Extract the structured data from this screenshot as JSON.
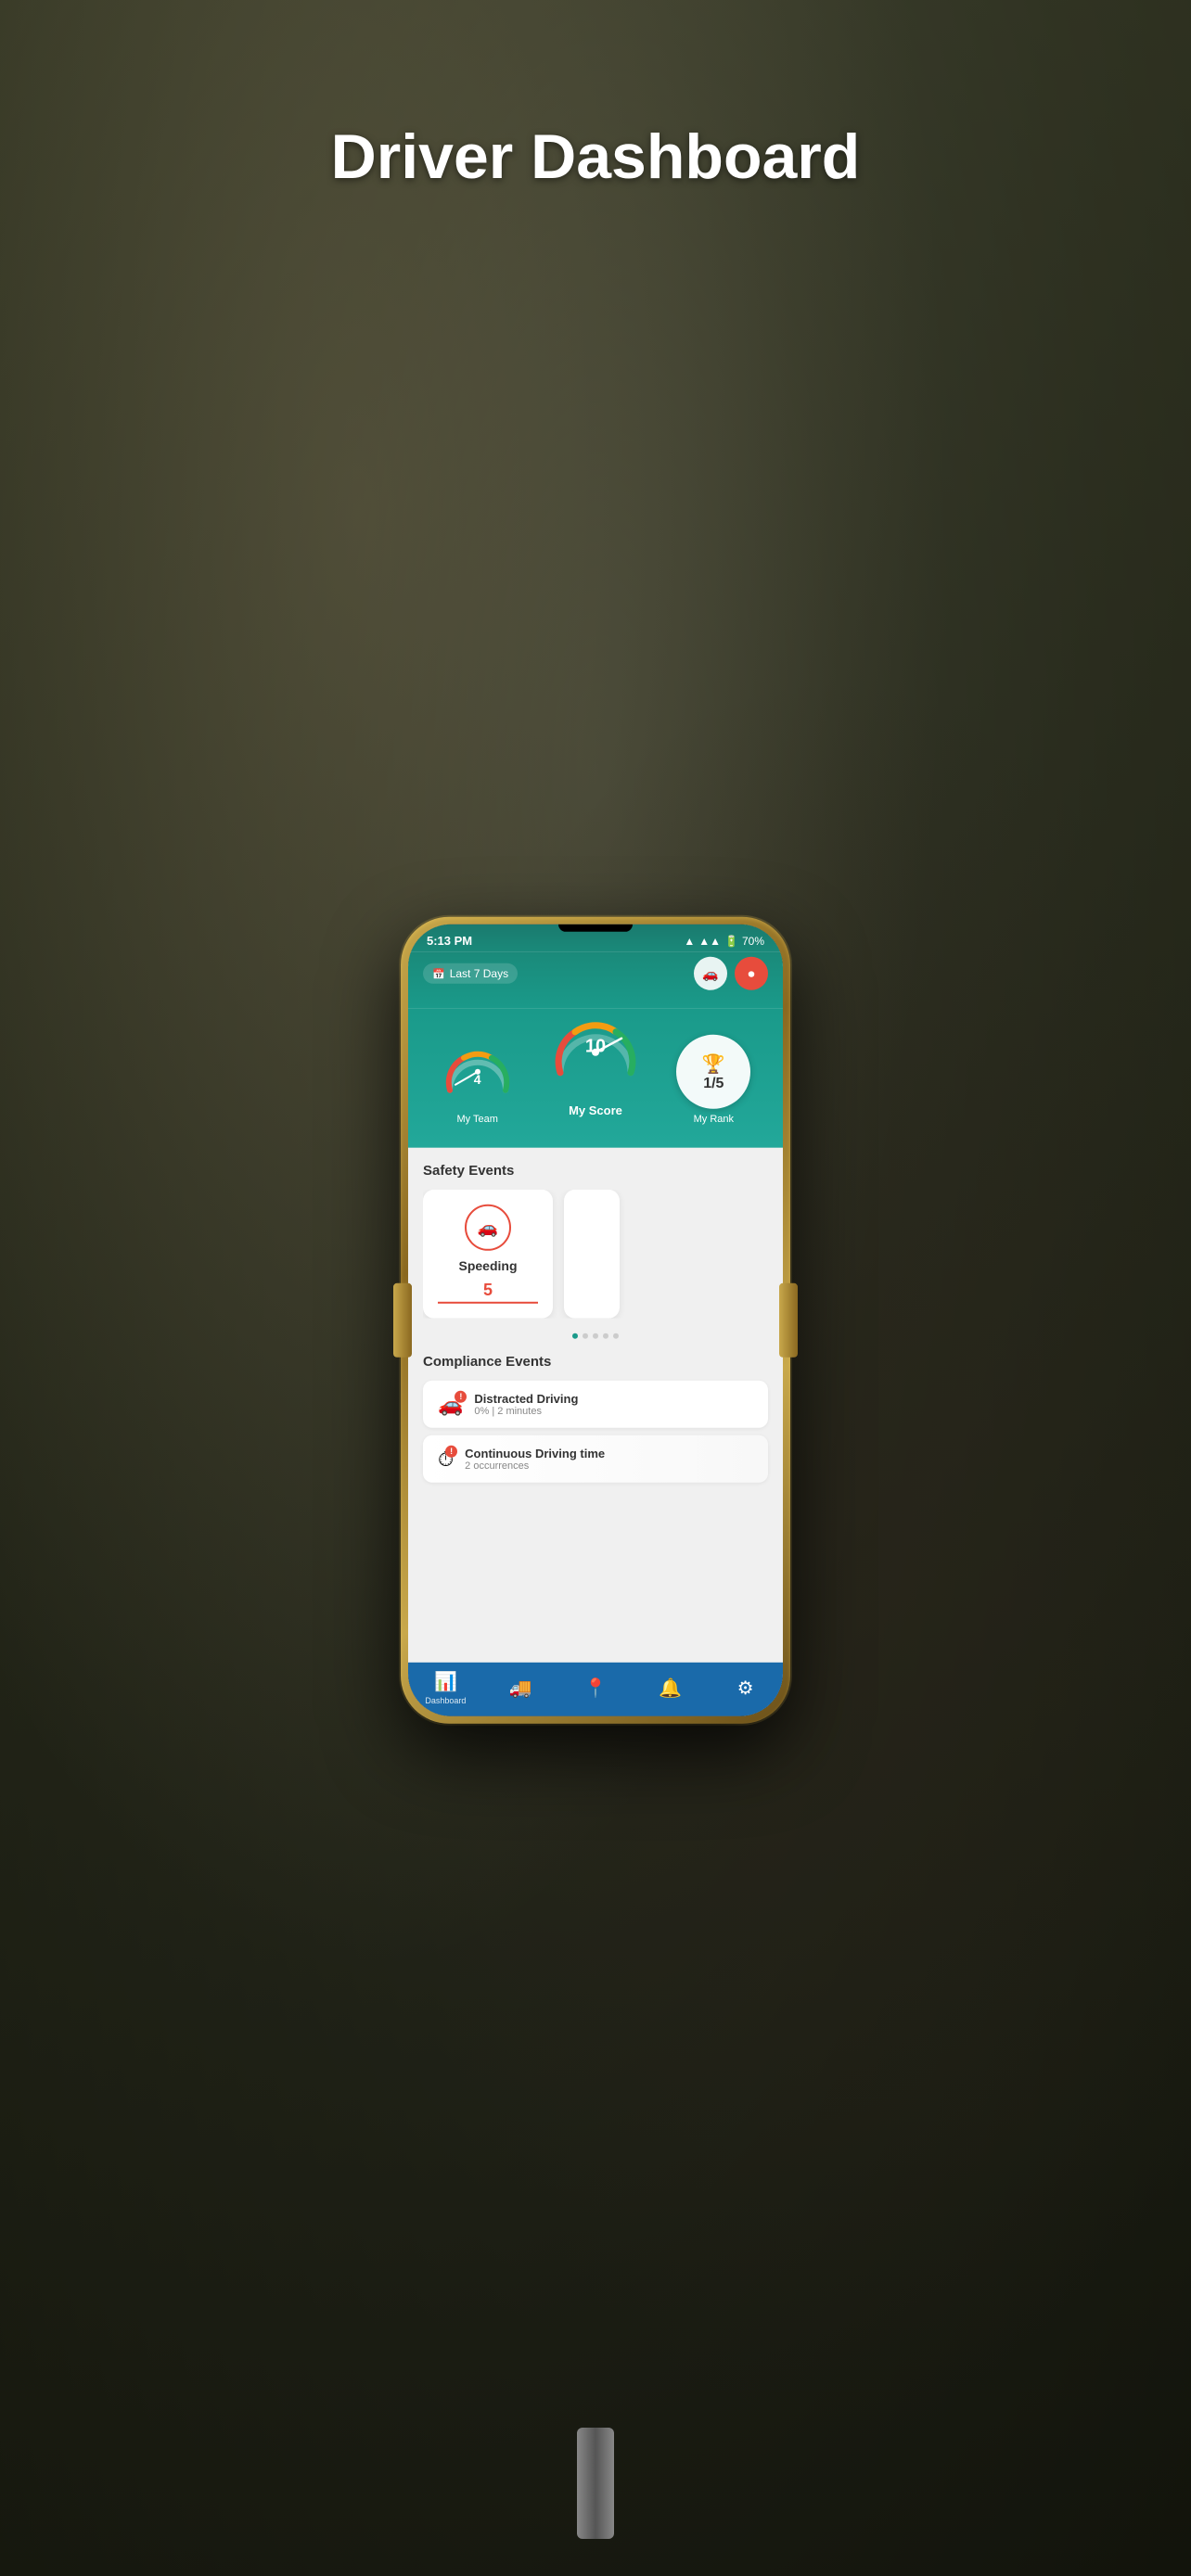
{
  "page": {
    "title": "Driver Dashboard",
    "background": "car-interior"
  },
  "phone": {
    "status_bar": {
      "time": "5:13 PM",
      "battery": "70%",
      "signal": "●●●",
      "wifi": "▲"
    },
    "header": {
      "date_filter": "Last 7 Days",
      "calendar_icon": "calendar-icon",
      "car_icon": "car-icon",
      "record_icon": "record-icon"
    },
    "scores": {
      "my_team": {
        "label": "My Team",
        "value": "4"
      },
      "my_score": {
        "label": "My Score",
        "value": "10"
      },
      "my_rank": {
        "label": "My Rank",
        "value": "1/5"
      }
    },
    "safety_events": {
      "title": "Safety Events",
      "cards": [
        {
          "name": "Speeding",
          "count": "5",
          "icon": "🚗"
        }
      ],
      "dots": [
        true,
        false,
        false,
        false,
        false
      ]
    },
    "compliance_events": {
      "title": "Compliance Events",
      "items": [
        {
          "name": "Distracted Driving",
          "detail": "0% | 2 minutes",
          "icon": "🚗",
          "has_warning": true
        },
        {
          "name": "Continuous Driving time",
          "detail": "2 occurrences",
          "icon": "⏱",
          "has_warning": true
        }
      ]
    },
    "bottom_nav": {
      "items": [
        {
          "label": "Dashboard",
          "icon": "📊",
          "active": true
        },
        {
          "label": "",
          "icon": "🚚",
          "active": false
        },
        {
          "label": "",
          "icon": "📍",
          "active": false
        },
        {
          "label": "",
          "icon": "🔔",
          "active": false
        },
        {
          "label": "",
          "icon": "⚙",
          "active": false
        }
      ]
    }
  }
}
